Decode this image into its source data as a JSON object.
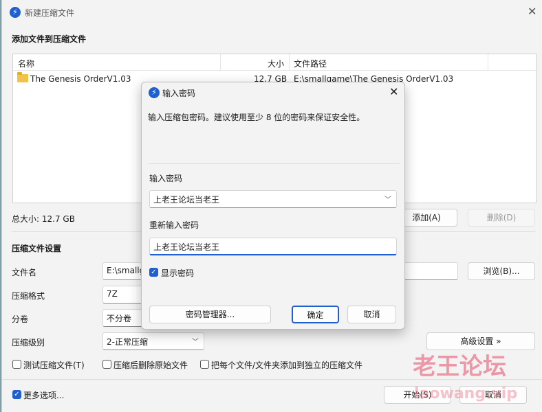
{
  "window": {
    "title": "新建压缩文件",
    "close": "✕"
  },
  "add_section": {
    "title": "添加文件到压缩文件"
  },
  "file_list": {
    "columns": [
      "名称",
      "大小",
      "文件路径"
    ],
    "rows": [
      {
        "name": "The Genesis OrderV1.03",
        "size": "12.7 GB",
        "path": "E:\\smallgame\\The Genesis OrderV1.03"
      }
    ]
  },
  "total_size": "总大小: 12.7 GB",
  "buttons": {
    "add": "添加(A)",
    "delete": "删除(D)",
    "browse": "浏览(B)...",
    "advanced": "高级设置 »",
    "start": "开始(S)",
    "cancel": "取消"
  },
  "settings": {
    "title": "压缩文件设置",
    "filename_label": "文件名",
    "filename_value": "E:\\smallg",
    "format_label": "压缩格式",
    "format_value": "7Z",
    "split_label": "分卷",
    "split_value": "不分卷",
    "level_label": "压缩级别",
    "level_value": "2-正常压缩"
  },
  "options": {
    "test": "测试压缩文件(T)",
    "delete_after": "压缩后删除原始文件",
    "each_separate": "把每个文件/文件夹添加到独立的压缩文件",
    "more": "更多选项..."
  },
  "dialog": {
    "title": "输入密码",
    "description": "输入压缩包密码。建议使用至少 8 位的密码来保证安全性。",
    "password_label": "输入密码",
    "password_value": "上老王论坛当老王",
    "confirm_label": "重新输入密码",
    "confirm_value": "上老王论坛当老王",
    "show_password": "显示密码",
    "manager": "密码管理器...",
    "ok": "确定",
    "cancel": "取消"
  },
  "watermark": {
    "text": "老王论坛",
    "sub": "laowang.vip"
  },
  "colors": {
    "accent": "#1f5fcf"
  }
}
